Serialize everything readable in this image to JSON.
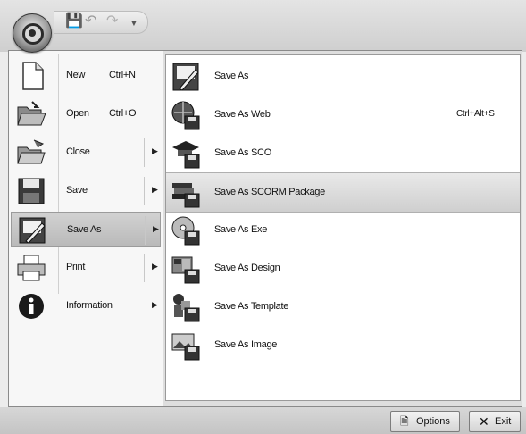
{
  "quick_access": {
    "icons": [
      "save-icon",
      "undo-icon",
      "redo-icon",
      "customize-icon"
    ]
  },
  "menu": {
    "items": [
      {
        "label": "New",
        "shortcut": "Ctrl+N",
        "icon": "new-document-icon",
        "submenu": false
      },
      {
        "label": "Open",
        "shortcut": "Ctrl+O",
        "icon": "open-folder-icon",
        "submenu": false
      },
      {
        "label": "Close",
        "shortcut": "",
        "icon": "close-document-icon",
        "submenu": true
      },
      {
        "label": "Save",
        "shortcut": "",
        "icon": "floppy-disk-icon",
        "submenu": true
      },
      {
        "label": "Save As",
        "shortcut": "",
        "icon": "save-as-icon",
        "submenu": true,
        "active": true
      },
      {
        "label": "Print",
        "shortcut": "",
        "icon": "printer-icon",
        "submenu": true
      },
      {
        "label": "Information",
        "shortcut": "",
        "icon": "information-icon",
        "submenu": true
      }
    ],
    "submenu_items": [
      {
        "label": "Save As",
        "shortcut": "",
        "icon": "save-as-icon"
      },
      {
        "label": "Save As Web",
        "shortcut": "Ctrl+Alt+S",
        "icon": "globe-disk-icon"
      },
      {
        "label": "Save As SCO",
        "shortcut": "",
        "icon": "graduation-cap-disk-icon"
      },
      {
        "label": "Save As SCORM Package",
        "shortcut": "",
        "icon": "books-disk-icon",
        "highlighted": true
      },
      {
        "label": "Save As Exe",
        "shortcut": "",
        "icon": "cd-disk-icon"
      },
      {
        "label": "Save As Design",
        "shortcut": "",
        "icon": "design-disk-icon"
      },
      {
        "label": "Save As Template",
        "shortcut": "",
        "icon": "template-disk-icon"
      },
      {
        "label": "Save As Image",
        "shortcut": "",
        "icon": "image-disk-icon"
      }
    ]
  },
  "footer": {
    "options_label": "Options",
    "exit_label": "Exit"
  }
}
